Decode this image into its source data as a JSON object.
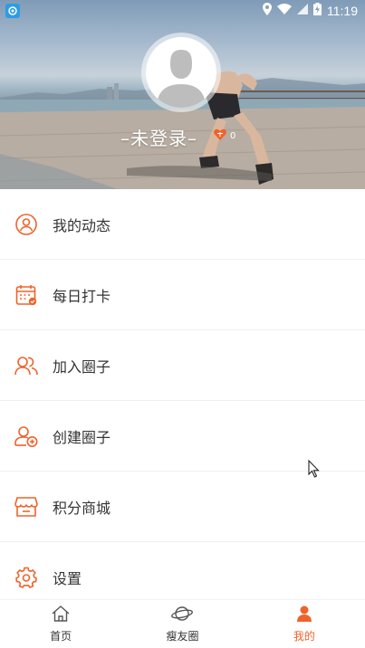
{
  "status_bar": {
    "time": "11:19",
    "icons": [
      "app-notification-icon",
      "location-icon",
      "wifi-icon",
      "cellular-signal-icon",
      "battery-charging-icon"
    ]
  },
  "profile": {
    "login_text": "–未登录–",
    "points": "0"
  },
  "menu": [
    {
      "key": "my-posts",
      "label": "我的动态",
      "icon": "user-circle-icon"
    },
    {
      "key": "daily-checkin",
      "label": "每日打卡",
      "icon": "calendar-check-icon"
    },
    {
      "key": "join-circle",
      "label": "加入圈子",
      "icon": "users-icon"
    },
    {
      "key": "create-circle",
      "label": "创建圈子",
      "icon": "user-add-icon"
    },
    {
      "key": "points-mall",
      "label": "积分商城",
      "icon": "store-icon"
    },
    {
      "key": "settings",
      "label": "设置",
      "icon": "gear-icon"
    }
  ],
  "bottom_nav": [
    {
      "key": "home",
      "label": "首页",
      "icon": "home-icon",
      "active": false
    },
    {
      "key": "friends-circle",
      "label": "瘦友圈",
      "icon": "planet-icon",
      "active": false
    },
    {
      "key": "mine",
      "label": "我的",
      "icon": "person-icon",
      "active": true
    }
  ],
  "colors": {
    "accent": "#f0622a",
    "text": "#333333",
    "divider": "#f0f0f0",
    "nav_inactive": "#333333"
  }
}
